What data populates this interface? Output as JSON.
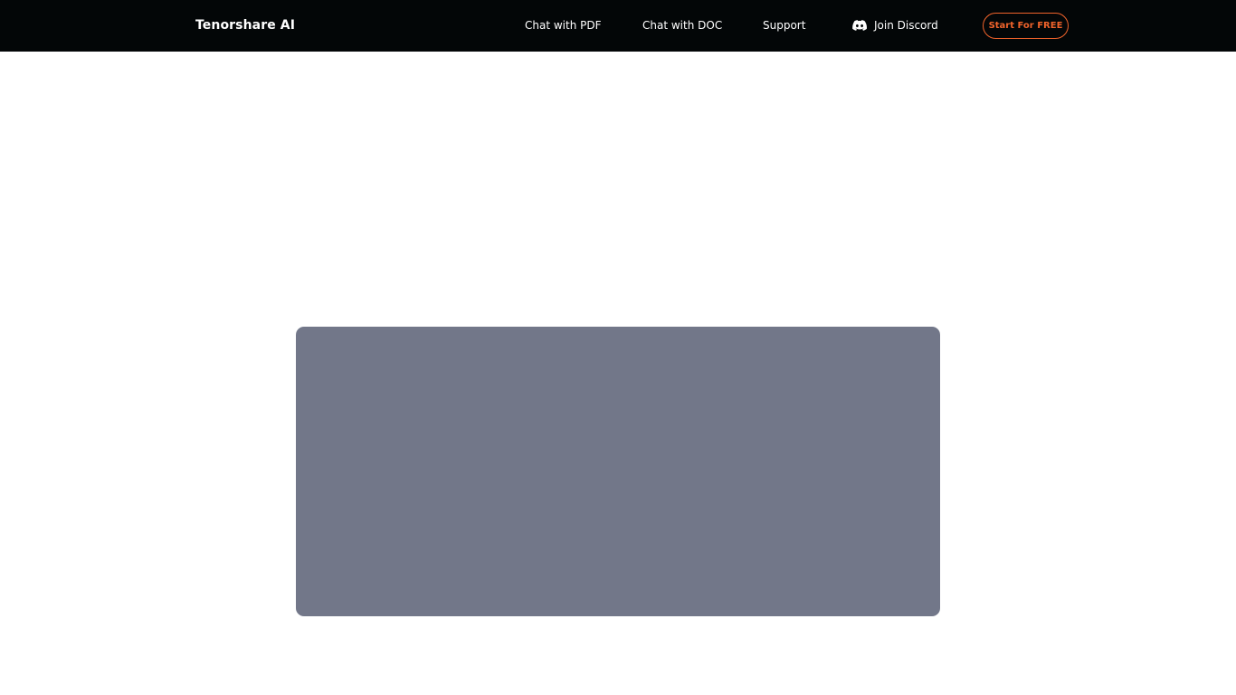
{
  "header": {
    "brand": "Tenorshare AI",
    "nav": {
      "chat_pdf": "Chat with PDF",
      "chat_doc": "Chat with DOC",
      "support": "Support",
      "discord": "Join Discord"
    },
    "cta_label": "Start For FREE"
  },
  "colors": {
    "header_bg": "#030607",
    "accent": "#f0632b",
    "media_placeholder": "#727789"
  },
  "icons": {
    "discord": "discord-icon"
  }
}
